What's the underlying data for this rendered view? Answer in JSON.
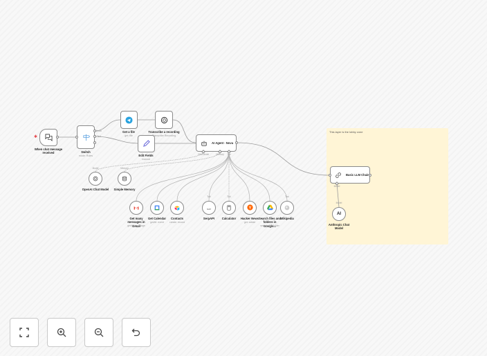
{
  "sticky_note": {
    "text": "This layer is the lobby zone"
  },
  "nodes": {
    "trigger": {
      "label": "When chat message received",
      "icon": "chat-icon"
    },
    "switch": {
      "label": "Switch",
      "sub": "mode: Rules",
      "outputs": [
        "Audio",
        "Text"
      ]
    },
    "get_file": {
      "label": "Get a file",
      "sub": "get: file",
      "icon": "telegram-icon"
    },
    "transcribe": {
      "label": "Transcribe a recording",
      "sub": "Transcribe Recording",
      "icon": "openai-icon"
    },
    "edit_fields": {
      "label": "Edit Fields",
      "sub": "manual",
      "icon": "pencil-icon"
    },
    "ai_agent": {
      "label": "AI Agent - Nova",
      "ports": [
        "Chat Model",
        "Memory",
        "Tool"
      ],
      "icon": "robot-icon"
    },
    "openai_model": {
      "label": "OpenAI Chat Model",
      "port": "Model"
    },
    "memory": {
      "label": "Simple Memory",
      "port": "Memory"
    },
    "tools": [
      {
        "label": "Get many messages in Gmail",
        "sub": "getAll: message",
        "icon": "gmail-icon"
      },
      {
        "label": "Get Calendar",
        "sub": "getAll: event",
        "icon": "google-calendar-icon"
      },
      {
        "label": "Contacts",
        "sub": "create: record",
        "icon": "airtable-icon"
      },
      {
        "label": "SerpAPI",
        "sub": "",
        "icon": "serpapi-icon",
        "port": "Tool"
      },
      {
        "label": "Calculator",
        "sub": "",
        "icon": "calculator-icon",
        "port": "Tool"
      },
      {
        "label": "Hacker News",
        "sub": "get: article",
        "icon": "hacker-news-icon"
      },
      {
        "label": "Search files and folders in Google...",
        "sub": "search: fileFolder",
        "icon": "google-drive-icon"
      },
      {
        "label": "Wikipedia",
        "sub": "",
        "icon": "wikipedia-icon",
        "port": "Tool"
      }
    ],
    "llm_chain": {
      "label": "Basic LLM Chain",
      "port": "Model",
      "icon": "link-icon"
    },
    "anthropic": {
      "label": "Anthropic Chat Model",
      "port": "Model",
      "glyph": "AI"
    }
  },
  "controls": [
    {
      "name": "fit-view",
      "icon": "fullscreen-icon"
    },
    {
      "name": "zoom-in",
      "icon": "zoom-in-icon"
    },
    {
      "name": "zoom-out",
      "icon": "zoom-out-icon"
    },
    {
      "name": "undo",
      "icon": "undo-icon"
    }
  ],
  "colors": {
    "sticky": "#fff5d6",
    "telegram": "#2aa3df",
    "hacker_news": "#ff6600",
    "required": "#e5484d"
  }
}
